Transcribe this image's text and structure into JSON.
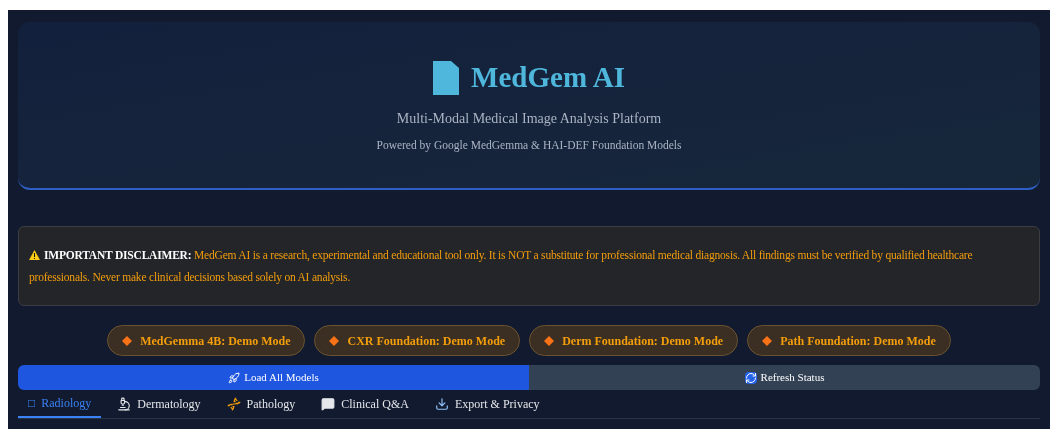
{
  "header": {
    "title": "MedGem AI",
    "subtitle": "Multi-Modal Medical Image Analysis Platform",
    "powered_by": "Powered by Google MedGemma & HAI-DEF Foundation Models"
  },
  "disclaimer": {
    "label": "IMPORTANT DISCLAIMER:",
    "text": "MedGem AI is a research, experimental and educational tool only. It is NOT a substitute for professional medical diagnosis. All findings must be verified by qualified healthcare professionals. Never make clinical decisions based solely on AI analysis."
  },
  "model_status": [
    {
      "label": "MedGemma 4B: Demo Mode"
    },
    {
      "label": "CXR Foundation: Demo Mode"
    },
    {
      "label": "Derm Foundation: Demo Mode"
    },
    {
      "label": "Path Foundation: Demo Mode"
    }
  ],
  "actions": [
    {
      "kind": "primary",
      "label": "Load All Models"
    },
    {
      "kind": "secondary",
      "label": "Refresh Status"
    }
  ],
  "tabs": [
    {
      "kind": "glyph",
      "glyph": "□",
      "label": "Radiology",
      "selected": true
    },
    {
      "kind": "dermatology",
      "label": "Dermatology",
      "selected": false
    },
    {
      "kind": "pathology",
      "label": "Pathology",
      "selected": false
    },
    {
      "kind": "qa",
      "label": "Clinical Q&A",
      "selected": false
    },
    {
      "kind": "export",
      "label": "Export & Privacy",
      "selected": false
    }
  ]
}
